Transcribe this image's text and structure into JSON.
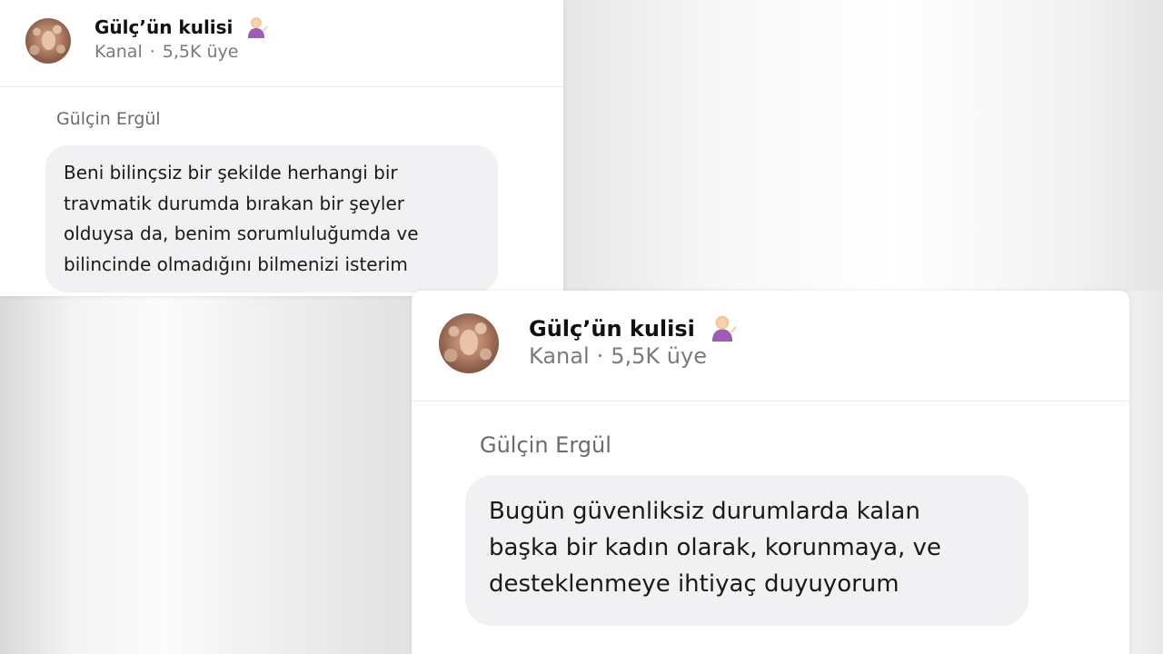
{
  "posts": [
    {
      "channel_name": "Gülç’ün kulisi",
      "channel_type": "Kanal",
      "members": "5,5K üye",
      "separator": "·",
      "emoji_icon": "woman-tipping-hand-icon",
      "sender": "Gülçin Ergül",
      "message_lines": [
        "Beni bilinçsiz bir şekilde herhangi bir",
        "travmatik durumda bırakan bir şeyler",
        "olduysa da, benim sorumluluğumda ve",
        "bilincinde olmadığını bilmenizi isterim"
      ]
    },
    {
      "channel_name": "Gülç’ün kulisi",
      "channel_type": "Kanal",
      "members": "5,5K üye",
      "separator": "·",
      "emoji_icon": "woman-tipping-hand-icon",
      "sender": "Gülçin Ergül",
      "message_lines": [
        "Bugün güvenliksiz durumlarda kalan",
        "başka bir kadın olarak, korunmaya, ve",
        "desteklenmeye ihtiyaç duyuyorum"
      ]
    }
  ],
  "colors": {
    "bubble_bg": "#f1f1f3",
    "card_bg": "#ffffff",
    "secondary_text": "#7a7a7a"
  }
}
